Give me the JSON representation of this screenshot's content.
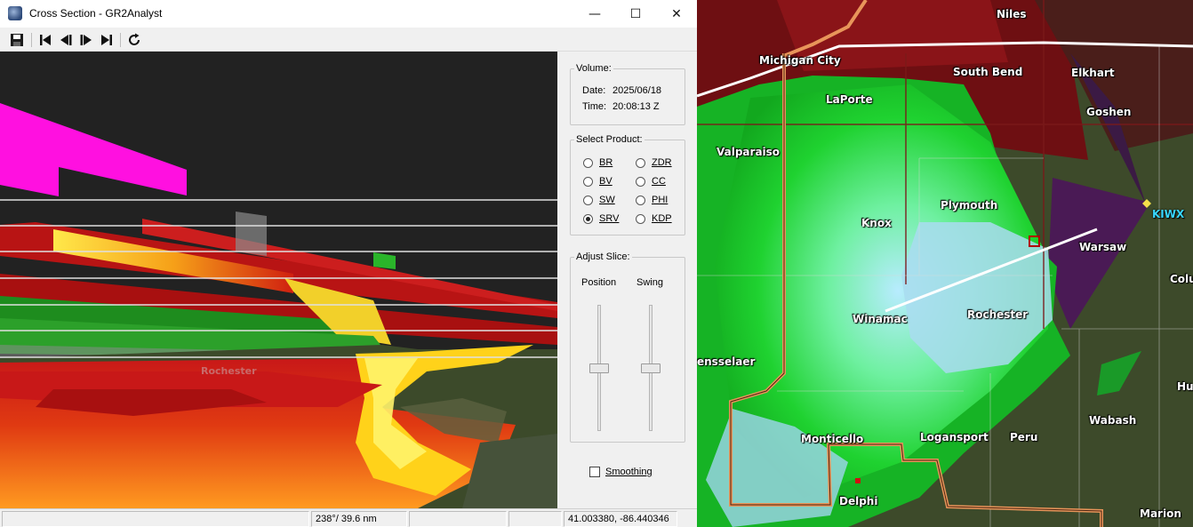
{
  "window": {
    "title": "Cross Section - GR2Analyst",
    "controls": {
      "minimize": "—",
      "maximize": "☐",
      "close": "✕"
    }
  },
  "toolbar": {
    "items": [
      "save-icon",
      "skip-first-icon",
      "step-back-icon",
      "step-forward-icon",
      "skip-last-icon",
      "refresh-icon"
    ]
  },
  "cross_section": {
    "town_label": "Rochester"
  },
  "panel": {
    "volume": {
      "legend": "Volume:",
      "date_label": "Date:",
      "date_value": "2025/06/18",
      "time_label": "Time:",
      "time_value": "20:08:13 Z"
    },
    "products": {
      "legend": "Select Product:",
      "options": [
        "BR",
        "ZDR",
        "BV",
        "CC",
        "SW",
        "PHI",
        "SRV",
        "KDP"
      ],
      "selected": "SRV"
    },
    "slice": {
      "legend": "Adjust Slice:",
      "position_label": "Position",
      "swing_label": "Swing",
      "position_level": 0.5,
      "swing_level": 0.5
    },
    "smoothing": {
      "label": "Smoothing",
      "checked": false
    }
  },
  "status_bar": {
    "cells": [
      "",
      "238°/ 39.6 nm",
      "",
      "",
      "41.003380, -86.440346"
    ]
  },
  "map": {
    "station": "KIWX",
    "cities": [
      "Niles",
      "Michigan City",
      "South Bend",
      "Elkhart",
      "LaPorte",
      "Goshen",
      "Valparaiso",
      "Plymouth",
      "Knox",
      "Warsaw",
      "Winamac",
      "Rochester",
      "Colu",
      "ensselaer",
      "Hu",
      "Wabash",
      "Monticello",
      "Logansport",
      "Peru",
      "Delphi",
      "Marion"
    ]
  },
  "colors": {
    "titlebar": "#ffffff",
    "panel_bg": "#f0f0f0",
    "station_label": "#38d6ff",
    "highway": "#d08040",
    "interstate": "#ffffff",
    "county_line": "#7a1a1a"
  }
}
